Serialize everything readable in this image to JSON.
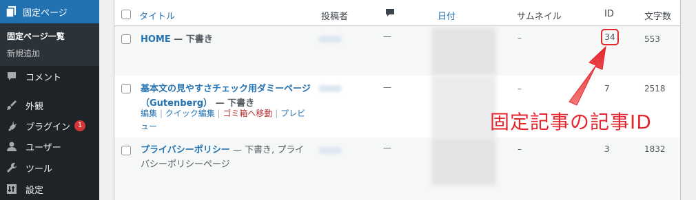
{
  "sidebar": {
    "current_menu": "固定ページ",
    "submenu": [
      "固定ページ一覧",
      "新規追加"
    ],
    "items": [
      {
        "label": "コメント",
        "icon": "comment-icon"
      },
      {
        "label": "外観",
        "icon": "brush-icon"
      },
      {
        "label": "プラグイン",
        "icon": "plugin-icon",
        "badge": "1"
      },
      {
        "label": "ユーザー",
        "icon": "user-icon"
      },
      {
        "label": "ツール",
        "icon": "wrench-icon"
      },
      {
        "label": "設定",
        "icon": "settings-icon"
      }
    ]
  },
  "table": {
    "columns": {
      "title": "タイトル",
      "author": "投稿者",
      "date": "日付",
      "thumbnail": "サムネイル",
      "id": "ID",
      "wordcount": "文字数"
    },
    "rows": [
      {
        "title": "HOME",
        "state": " — 下書き",
        "comments": "—",
        "thumbnail": "–",
        "id": "34",
        "words": "553"
      },
      {
        "title": "基本文の見やすさチェック用ダミーページ（Gutenberg）",
        "state": " — 下書き",
        "comments": "—",
        "thumbnail": "–",
        "id": "7",
        "words": "2518"
      },
      {
        "title": "プライバシーポリシー",
        "state": " — 下書き, プライバシーポリシーページ",
        "comments": "—",
        "thumbnail": "–",
        "id": "3",
        "words": "1832"
      }
    ],
    "row_actions": {
      "edit": "編集",
      "quick_edit": "クイック編集",
      "trash": "ゴミ箱へ移動",
      "preview": "プレビュー",
      "sep": " | ",
      "tail": "ー"
    }
  },
  "annotation": {
    "text": "固定記事の記事ID",
    "color": "#e3262d"
  },
  "colors": {
    "sidebar_bg": "#1d2327",
    "accent": "#2271b1",
    "badge": "#d63638"
  }
}
